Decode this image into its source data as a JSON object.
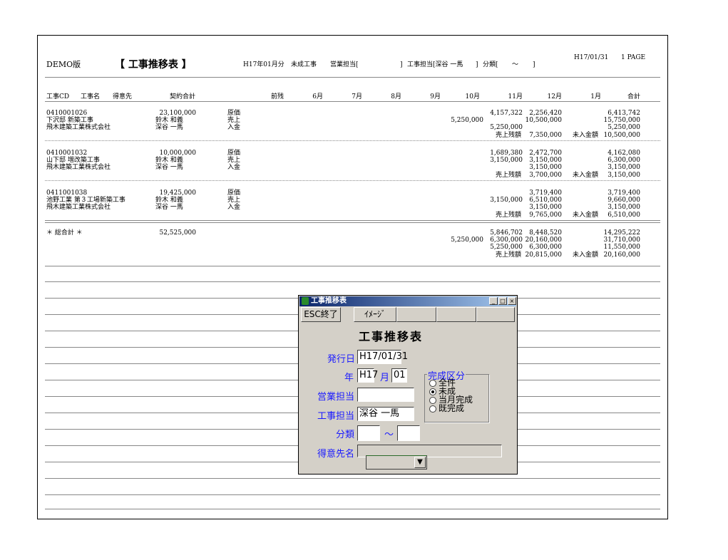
{
  "report": {
    "demo": "DEMO版",
    "title": "【 工事推移表 】",
    "period": "H17年01月分",
    "status": "未成工事",
    "sales_rep": "営業担当[",
    "sales_rep_close": "]",
    "eng_rep": "工事担当[深谷 一馬",
    "eng_rep_close": "]",
    "bunrui": "分類[",
    "tilde": "～",
    "bunrui_close": "]",
    "date": "H17/01/31",
    "page": "1 PAGE"
  },
  "columns": [
    "工事CD",
    "工事名",
    "得意先",
    "契約合計",
    "前残",
    "6月",
    "7月",
    "8月",
    "9月",
    "10月",
    "11月",
    "12月",
    "1月",
    "合計"
  ],
  "blocks": [
    {
      "cd": "0410001026",
      "name": "下沢邸 新築工事",
      "client": "飛木建築工業株式会社",
      "contract": "23,100,000",
      "rep1": "鈴木 和義",
      "rep2": "深谷 一馬",
      "labels": [
        "原価",
        "売上",
        "入金"
      ],
      "oct_sales": "5,250,000",
      "nov": [
        "4,157,322",
        "",
        "5,250,000"
      ],
      "dec": [
        "2,256,420",
        "10,500,000",
        ""
      ],
      "total": [
        "6,413,742",
        "15,750,000",
        "5,250,000"
      ],
      "rem_label": "売上残額",
      "rem": "7,350,000",
      "unpaid_label": "未入金額",
      "unpaid": "10,500,000"
    },
    {
      "cd": "0410001032",
      "name": "山下邸 増改築工事",
      "client": "飛木建築工業株式会社",
      "contract": "10,000,000",
      "rep1": "鈴木 和義",
      "rep2": "深谷 一馬",
      "labels": [
        "原価",
        "売上",
        "入金"
      ],
      "oct_sales": "",
      "nov": [
        "1,689,380",
        "3,150,000",
        ""
      ],
      "dec": [
        "2,472,700",
        "3,150,000",
        "3,150,000"
      ],
      "total": [
        "4,162,080",
        "6,300,000",
        "3,150,000"
      ],
      "rem_label": "売上残額",
      "rem": "3,700,000",
      "unpaid_label": "未入金額",
      "unpaid": "3,150,000"
    },
    {
      "cd": "0411001038",
      "name": "池野工業 第３工場新築工事",
      "client": "飛木建築工業株式会社",
      "contract": "19,425,000",
      "rep1": "鈴木 和義",
      "rep2": "深谷 一馬",
      "labels": [
        "原価",
        "売上",
        "入金"
      ],
      "oct_sales": "",
      "nov": [
        "",
        "3,150,000",
        ""
      ],
      "dec": [
        "3,719,400",
        "6,510,000",
        "3,150,000"
      ],
      "total": [
        "3,719,400",
        "9,660,000",
        "3,150,000"
      ],
      "rem_label": "売上残額",
      "rem": "9,765,000",
      "unpaid_label": "未入金額",
      "unpaid": "6,510,000"
    }
  ],
  "grand": {
    "label": "＊ 総合計 ＊",
    "contract": "52,525,000",
    "oct_sales": "5,250,000",
    "nov": [
      "5,846,702",
      "6,300,000",
      "5,250,000"
    ],
    "dec": [
      "8,448,520",
      "20,160,000",
      "6,300,000"
    ],
    "total": [
      "14,295,222",
      "31,710,000",
      "11,550,000"
    ],
    "rem_label": "売上残額",
    "rem": "20,815,000",
    "unpaid_label": "未入金額",
    "unpaid": "20,160,000"
  },
  "dialog": {
    "title": "工事推移表",
    "esc_button": "ESC終了",
    "image_button": "ｲﾒｰｼﾞ",
    "heading": "工事推移表",
    "issue_date_label": "発行日",
    "issue_date": "H17/01/31",
    "year_label": "年",
    "year": "H17",
    "month_label": "月",
    "month": "01",
    "sales_rep_label": "営業担当",
    "sales_rep": "",
    "eng_rep_label": "工事担当",
    "eng_rep": "深谷 一馬",
    "bunrui_label": "分類",
    "bunrui_from": "",
    "bunrui_tilde": "～",
    "bunrui_to": "",
    "client_label": "得意先名",
    "client": "",
    "completion_group": "完成区分",
    "completion_options": [
      "全件",
      "未成",
      "当月完成",
      "既完成"
    ],
    "completion_selected": "未成",
    "min_btn": "_",
    "max_btn": "□",
    "close_btn": "×"
  }
}
